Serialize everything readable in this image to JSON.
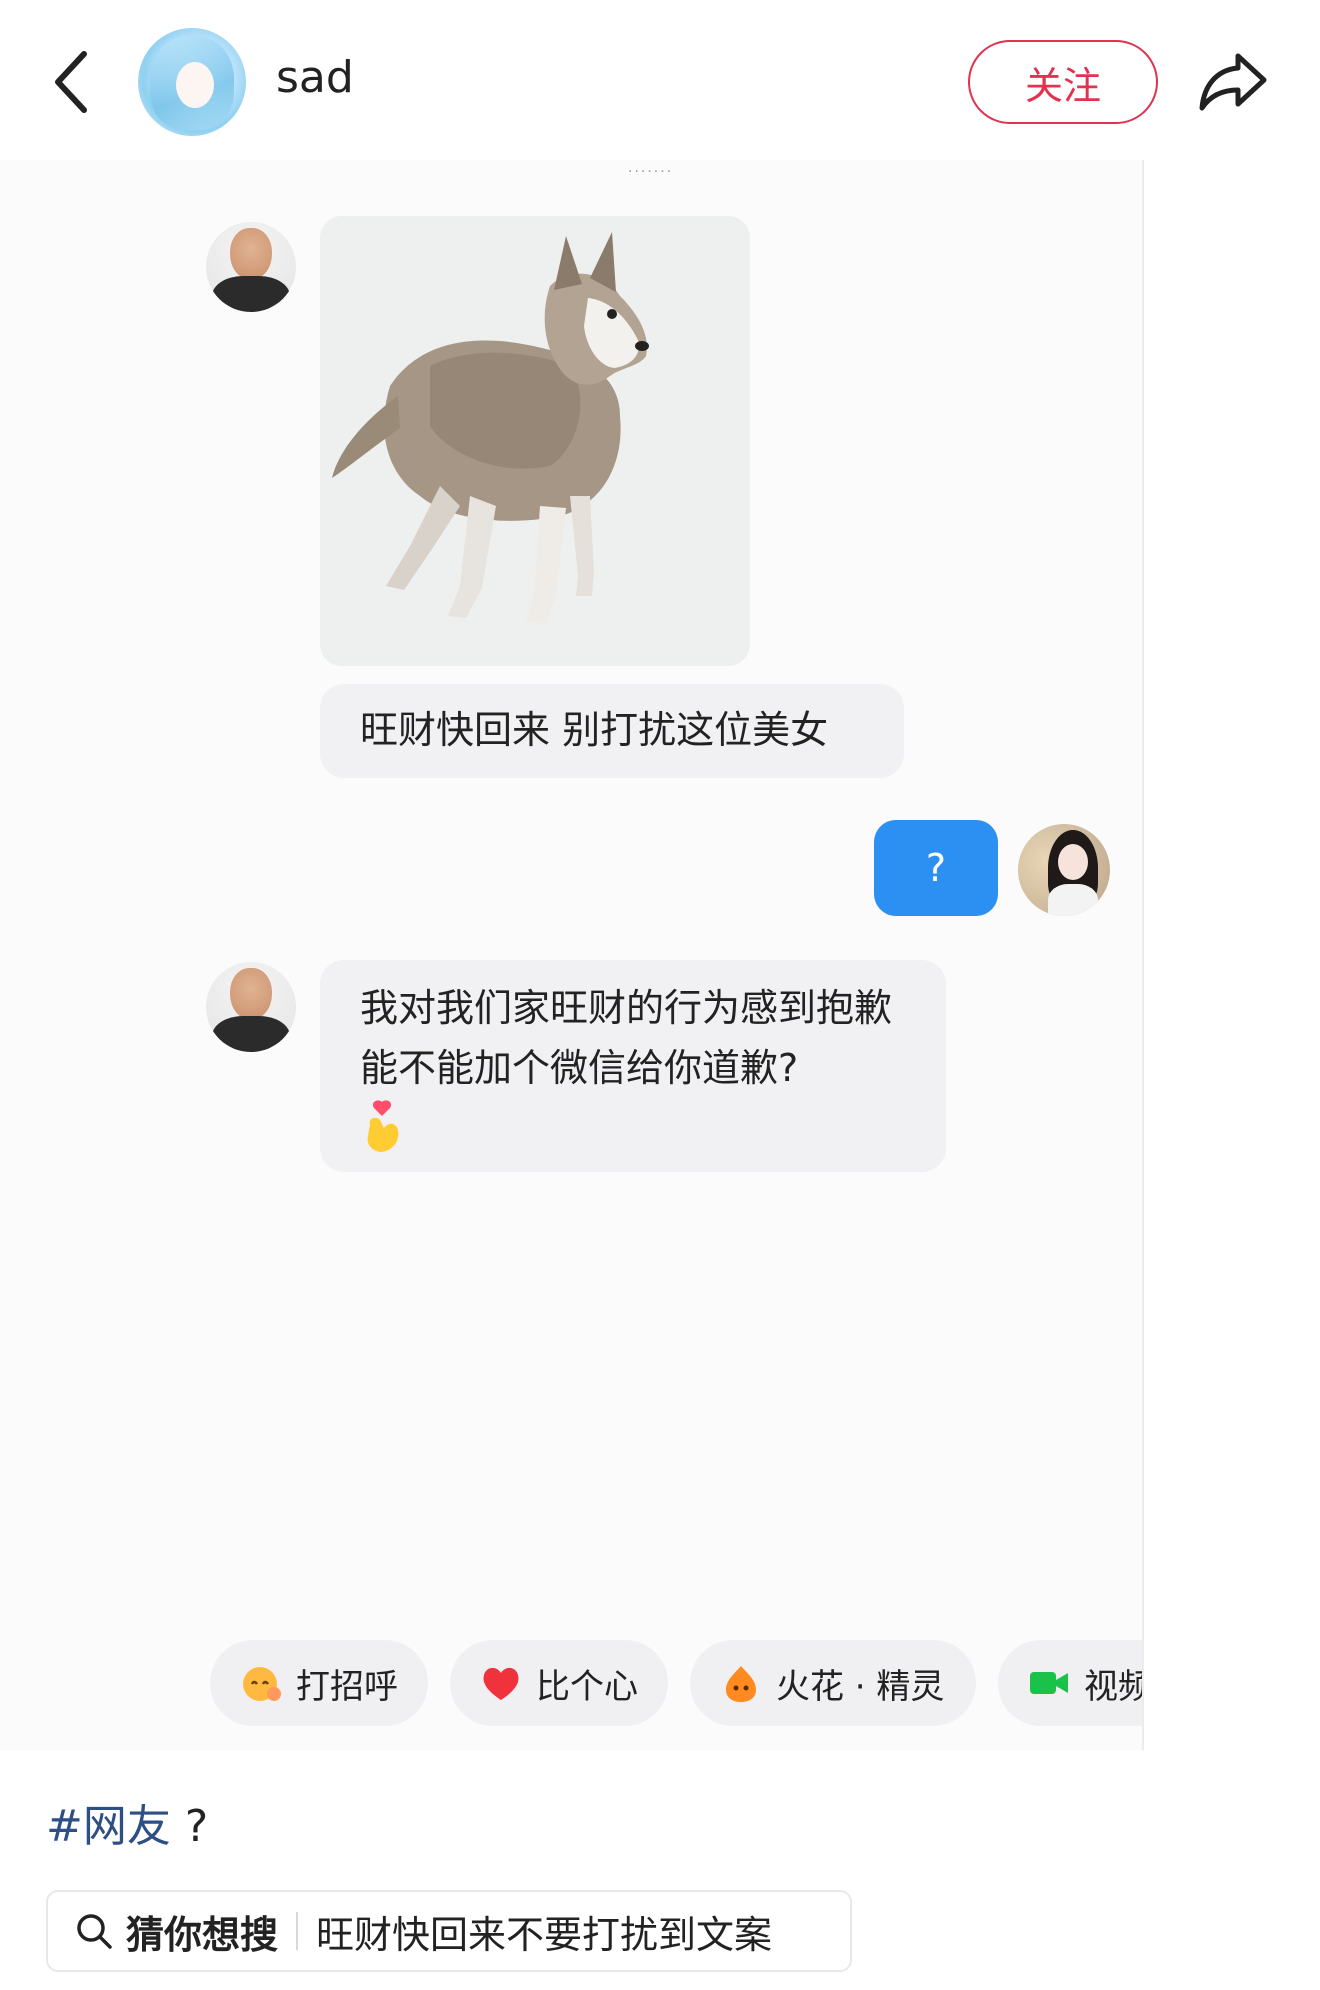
{
  "header": {
    "username": "sad",
    "follow_label": "关注"
  },
  "chat": {
    "top_dots": "·······",
    "messages": [
      {
        "sender": "other",
        "type": "image",
        "content": "dog image"
      },
      {
        "sender": "other",
        "type": "text",
        "text": "旺财快回来 别打扰这位美女"
      },
      {
        "sender": "me",
        "type": "text",
        "text": "?"
      },
      {
        "sender": "other",
        "type": "text",
        "text": "我对我们家旺财的行为感到抱歉 能不能加个微信给你道歉?",
        "emoji": "finger-heart-icon"
      }
    ]
  },
  "quick_actions": [
    {
      "icon": "wave-face-icon",
      "label": "打招呼"
    },
    {
      "icon": "heart-icon",
      "label": "比个心"
    },
    {
      "icon": "spark-sprite-icon",
      "label": "火花 · 精灵"
    },
    {
      "icon": "video-icon",
      "label": "视频"
    }
  ],
  "caption": {
    "hashtag": "#网友",
    "suffix": " ?"
  },
  "search": {
    "label": "猜你想搜",
    "query": "旺财快回来不要打扰到文案"
  },
  "colors": {
    "follow_red": "#e0334f",
    "my_bubble_blue": "#2c8ff2",
    "hashtag_blue": "#2c4f85",
    "bubble_gray": "#f1f1f3"
  }
}
